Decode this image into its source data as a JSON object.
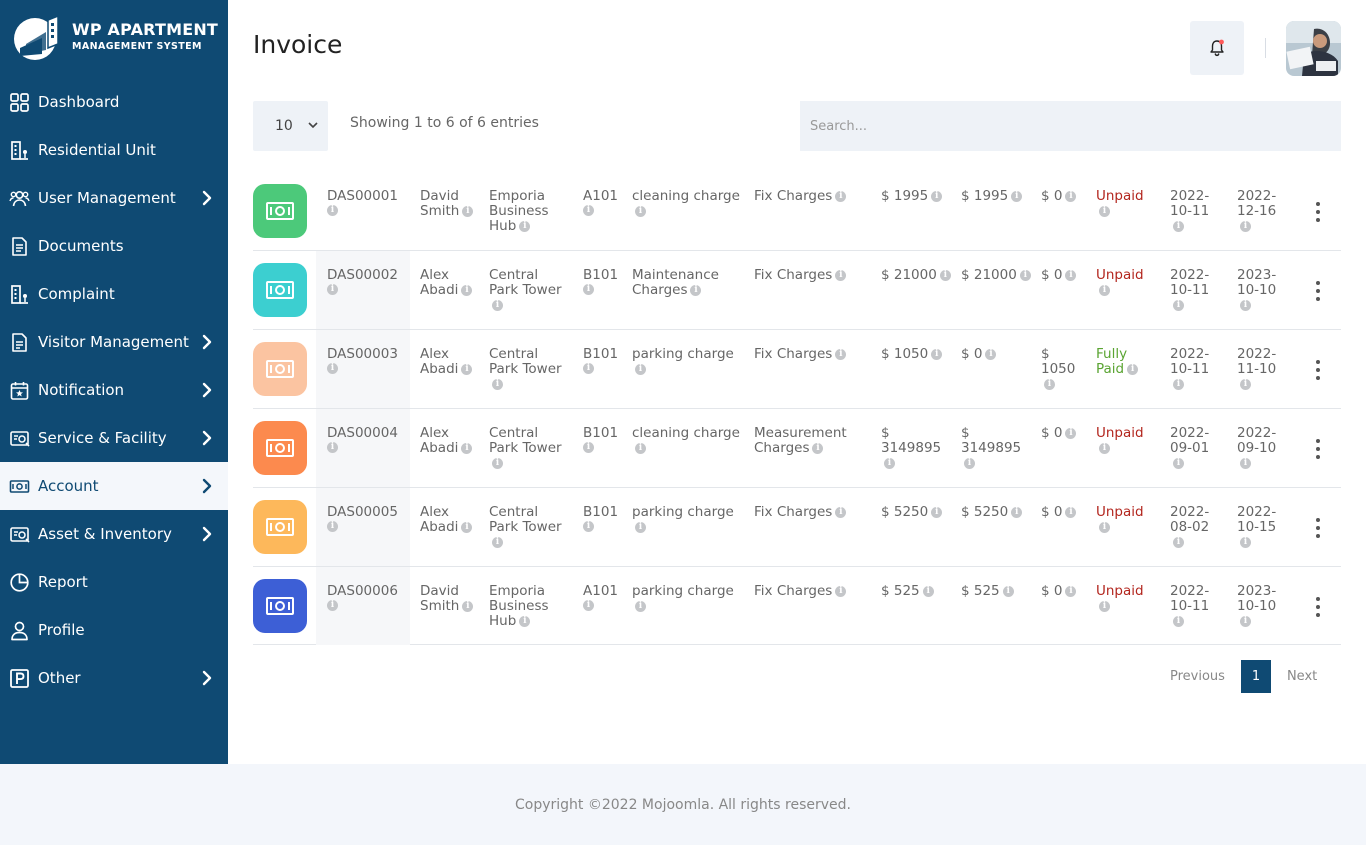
{
  "brand": {
    "title": "WP APARTMENT",
    "subtitle": "MANAGEMENT SYSTEM"
  },
  "sidebar": {
    "items": [
      {
        "label": "Dashboard",
        "icon": "dashboard-grid-icon",
        "chevron": false
      },
      {
        "label": "Residential Unit",
        "icon": "building-icon",
        "chevron": false
      },
      {
        "label": "User Management",
        "icon": "users-icon",
        "chevron": true
      },
      {
        "label": "Documents",
        "icon": "document-icon",
        "chevron": false
      },
      {
        "label": "Complaint",
        "icon": "complaint-building-icon",
        "chevron": false
      },
      {
        "label": "Visitor Management",
        "icon": "visitor-document-icon",
        "chevron": true
      },
      {
        "label": "Notification",
        "icon": "calendar-star-icon",
        "chevron": true
      },
      {
        "label": "Service & Facility",
        "icon": "service-card-icon",
        "chevron": true
      },
      {
        "label": "Account",
        "icon": "money-icon",
        "chevron": true,
        "active": true
      },
      {
        "label": "Asset & Inventory",
        "icon": "asset-card-icon",
        "chevron": true
      },
      {
        "label": "Report",
        "icon": "pie-chart-icon",
        "chevron": false
      },
      {
        "label": "Profile",
        "icon": "user-icon",
        "chevron": false
      },
      {
        "label": "Other",
        "icon": "parking-icon",
        "chevron": true
      }
    ]
  },
  "header": {
    "title": "Invoice"
  },
  "table_controls": {
    "length_value": "10",
    "info": "Showing 1 to 6 of 6 entries",
    "search_placeholder": "Search..."
  },
  "rows": [
    {
      "color": "#4cc97a",
      "id": "DAS00001",
      "name": "David Smith",
      "building": "Emporia Business Hub",
      "unit": "A101",
      "charge": "cleaning charge",
      "charge_type": "Fix Charges",
      "amount": "$ 1995",
      "total": "$ 1995",
      "paid": "$ 0",
      "status": "Unpaid",
      "issue": "2022-10-11",
      "due": "2022-12-16"
    },
    {
      "color": "#3ccfd0",
      "id": "DAS00002",
      "name": "Alex Abadi",
      "building": "Central Park Tower",
      "unit": "B101",
      "charge": "Maintenance Charges",
      "charge_type": "Fix Charges",
      "amount": "$ 21000",
      "total": "$ 21000",
      "paid": "$ 0",
      "status": "Unpaid",
      "issue": "2022-10-11",
      "due": "2023-10-10"
    },
    {
      "color": "#fbc4a1",
      "id": "DAS00003",
      "name": "Alex Abadi",
      "building": "Central Park Tower",
      "unit": "B101",
      "charge": "parking charge",
      "charge_type": "Fix Charges",
      "amount": "$ 1050",
      "total": "$ 0",
      "paid": "$ 1050",
      "status": "Fully Paid",
      "issue": "2022-10-11",
      "due": "2022-11-10"
    },
    {
      "color": "#fc8a4e",
      "id": "DAS00004",
      "name": "Alex Abadi",
      "building": "Central Park Tower",
      "unit": "B101",
      "charge": "cleaning charge",
      "charge_type": "Measurement Charges",
      "amount": "$ 3149895",
      "total": "$ 3149895",
      "paid": "$ 0",
      "status": "Unpaid",
      "issue": "2022-09-01",
      "due": "2022-09-10"
    },
    {
      "color": "#fdb85b",
      "id": "DAS00005",
      "name": "Alex Abadi",
      "building": "Central Park Tower",
      "unit": "B101",
      "charge": "parking charge",
      "charge_type": "Fix Charges",
      "amount": "$ 5250",
      "total": "$ 5250",
      "paid": "$ 0",
      "status": "Unpaid",
      "issue": "2022-08-02",
      "due": "2022-10-15"
    },
    {
      "color": "#3d5fd6",
      "id": "DAS00006",
      "name": "David Smith",
      "building": "Emporia Business Hub",
      "unit": "A101",
      "charge": "parking charge",
      "charge_type": "Fix Charges",
      "amount": "$ 525",
      "total": "$ 525",
      "paid": "$ 0",
      "status": "Unpaid",
      "issue": "2022-10-11",
      "due": "2023-10-10"
    }
  ],
  "pagination": {
    "prev": "Previous",
    "current": "1",
    "next": "Next"
  },
  "footer": {
    "text": "Copyright ©2022 Mojoomla. All rights reserved."
  },
  "colors": {
    "sidebar": "#0f4a73",
    "unpaid": "#b3261e",
    "paid": "#5aa432"
  }
}
